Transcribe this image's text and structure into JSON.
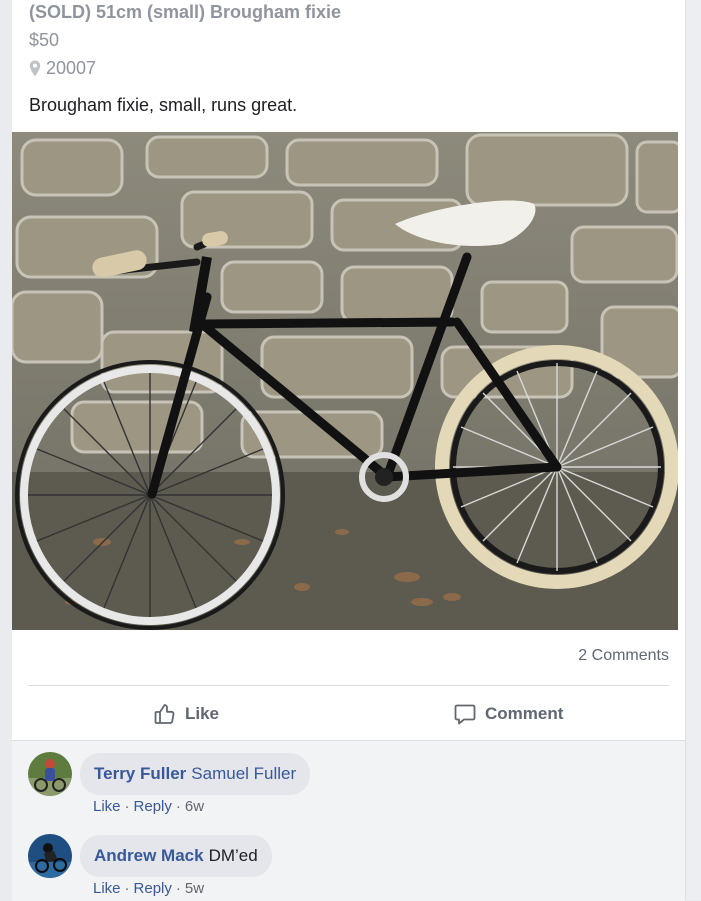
{
  "post": {
    "title": "(SOLD) 51cm (small) Brougham fixie",
    "price": "$50",
    "location": "20007",
    "description": "Brougham fixie, small, runs great.",
    "comments_count": "2 Comments"
  },
  "actions": {
    "like": "Like",
    "comment": "Comment"
  },
  "comments": [
    {
      "author": "Terry Fuller",
      "text": "",
      "mention": "Samuel Fuller",
      "like": "Like",
      "reply": "Reply",
      "time": "6w"
    },
    {
      "author": "Andrew Mack",
      "text": "DM’ed",
      "mention": "",
      "like": "Like",
      "reply": "Reply",
      "time": "5w"
    }
  ],
  "colors": {
    "link": "#385898",
    "muted": "#90949c",
    "text": "#1c1e21"
  },
  "icons": {
    "location": "location-pin-icon",
    "like": "thumbs-up-icon",
    "comment": "speech-bubble-icon"
  }
}
